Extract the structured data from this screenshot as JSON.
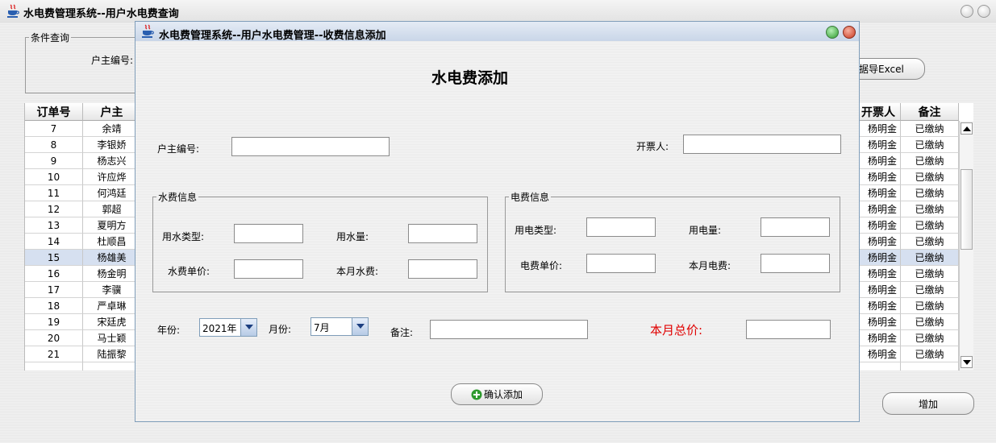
{
  "main_window": {
    "title": "水电费管理系统--用户水电费查询",
    "condition_group": {
      "legend": "条件查询",
      "owner_id_label": "户主编号:"
    },
    "export_button": "据导Excel",
    "add_button": "增加"
  },
  "table": {
    "headers": [
      "订单号",
      "户主",
      "开票人",
      "备注"
    ],
    "rows": [
      {
        "id": "7",
        "owner": "余靖",
        "issuer": "杨明金",
        "note": "已缴纳"
      },
      {
        "id": "8",
        "owner": "李银娇",
        "issuer": "杨明金",
        "note": "已缴纳"
      },
      {
        "id": "9",
        "owner": "杨志兴",
        "issuer": "杨明金",
        "note": "已缴纳"
      },
      {
        "id": "10",
        "owner": "许应烨",
        "issuer": "杨明金",
        "note": "已缴纳"
      },
      {
        "id": "11",
        "owner": "何鸿廷",
        "issuer": "杨明金",
        "note": "已缴纳"
      },
      {
        "id": "12",
        "owner": "郭超",
        "issuer": "杨明金",
        "note": "已缴纳"
      },
      {
        "id": "13",
        "owner": "夏明方",
        "issuer": "杨明金",
        "note": "已缴纳"
      },
      {
        "id": "14",
        "owner": "杜顺昌",
        "issuer": "杨明金",
        "note": "已缴纳"
      },
      {
        "id": "15",
        "owner": "杨雄美",
        "issuer": "杨明金",
        "note": "已缴纳"
      },
      {
        "id": "16",
        "owner": "杨金明",
        "issuer": "杨明金",
        "note": "已缴纳"
      },
      {
        "id": "17",
        "owner": "李骥",
        "issuer": "杨明金",
        "note": "已缴纳"
      },
      {
        "id": "18",
        "owner": "严卓琳",
        "issuer": "杨明金",
        "note": "已缴纳"
      },
      {
        "id": "19",
        "owner": "宋廷虎",
        "issuer": "杨明金",
        "note": "已缴纳"
      },
      {
        "id": "20",
        "owner": "马士颖",
        "issuer": "杨明金",
        "note": "已缴纳"
      },
      {
        "id": "21",
        "owner": "陆振黎",
        "issuer": "杨明金",
        "note": "已缴纳"
      }
    ],
    "selected_row": "15"
  },
  "dialog": {
    "title": "水电费管理系统--用户水电费管理--收费信息添加",
    "heading": "水电费添加",
    "owner_id_label": "户主编号:",
    "issuer_label": "开票人:",
    "water_group": {
      "legend": "水费信息",
      "type_label": "用水类型:",
      "amount_label": "用水量:",
      "unit_price_label": "水费单价:",
      "month_fee_label": "本月水费:"
    },
    "elec_group": {
      "legend": "电费信息",
      "type_label": "用电类型:",
      "amount_label": "用电量:",
      "unit_price_label": "电费单价:",
      "month_fee_label": "本月电费:"
    },
    "year_label": "年份:",
    "year_value": "2021年",
    "month_label": "月份:",
    "month_value": "7月",
    "remark_label": "备注:",
    "total_label": "本月总价:",
    "total_color": "#e00000",
    "confirm_button": "确认添加",
    "confirm_icon_color": "#2e9a2e"
  },
  "icons": {
    "app": "java-cup-icon",
    "dialog_buttons": [
      "minimize-green-icon",
      "close-red-icon"
    ]
  }
}
